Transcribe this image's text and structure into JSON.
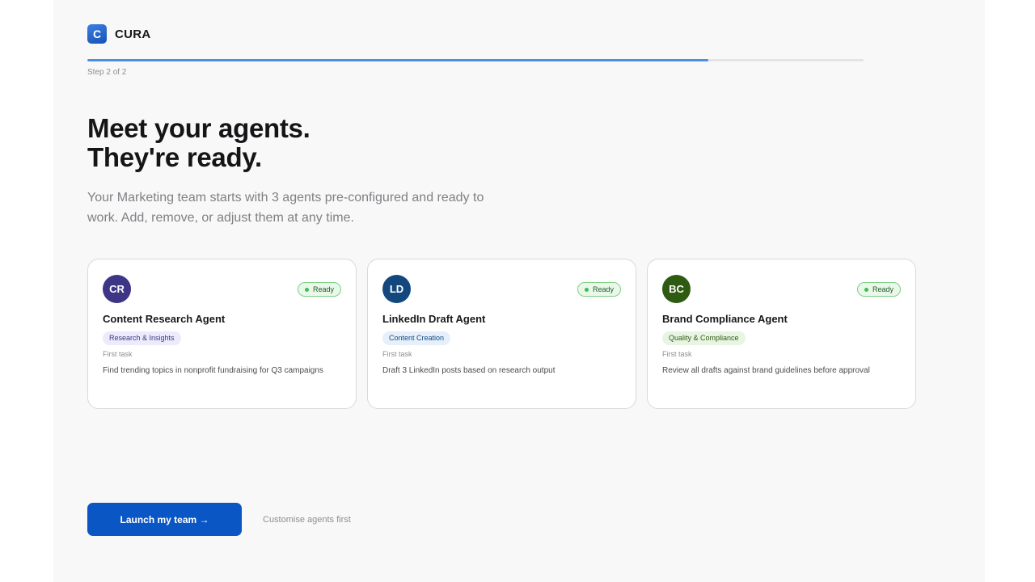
{
  "brand": {
    "letter": "C",
    "name": "CURA"
  },
  "progress": {
    "fraction": 0.8,
    "step_text": "Step 2 of 2"
  },
  "hero": {
    "title_line1": "Meet your agents.",
    "title_line2": "They're ready.",
    "subtitle": "Your Marketing team starts with 3 agents pre-configured and ready to work. Add, remove, or adjust them at any time."
  },
  "agents": [
    {
      "initials": "CR",
      "avatar_color": "#3d3585",
      "status": "Ready",
      "name": "Content Research Agent",
      "tag": "Research & Insights",
      "tag_bg": "#ecebfb",
      "tag_color": "#3d3585",
      "first_task_label": "First task",
      "first_task": "Find trending topics in nonprofit fundraising for Q3 campaigns"
    },
    {
      "initials": "LD",
      "avatar_color": "#13487f",
      "status": "Ready",
      "name": "LinkedIn Draft Agent",
      "tag": "Content Creation",
      "tag_bg": "#e6f0fb",
      "tag_color": "#13487f",
      "first_task_label": "First task",
      "first_task": "Draft 3 LinkedIn posts based on research output"
    },
    {
      "initials": "BC",
      "avatar_color": "#2f5a12",
      "status": "Ready",
      "name": "Brand Compliance Agent",
      "tag": "Quality & Compliance",
      "tag_bg": "#e8f5e3",
      "tag_color": "#2f5a12",
      "first_task_label": "First task",
      "first_task": "Review all drafts against brand guidelines before approval"
    }
  ],
  "actions": {
    "launch_label": "Launch my team →",
    "customise_label": "Customise agents first"
  },
  "colors": {
    "accent": "#0a56c4",
    "progress": "#4a8fe4",
    "ready_dot": "#3bbf55"
  }
}
